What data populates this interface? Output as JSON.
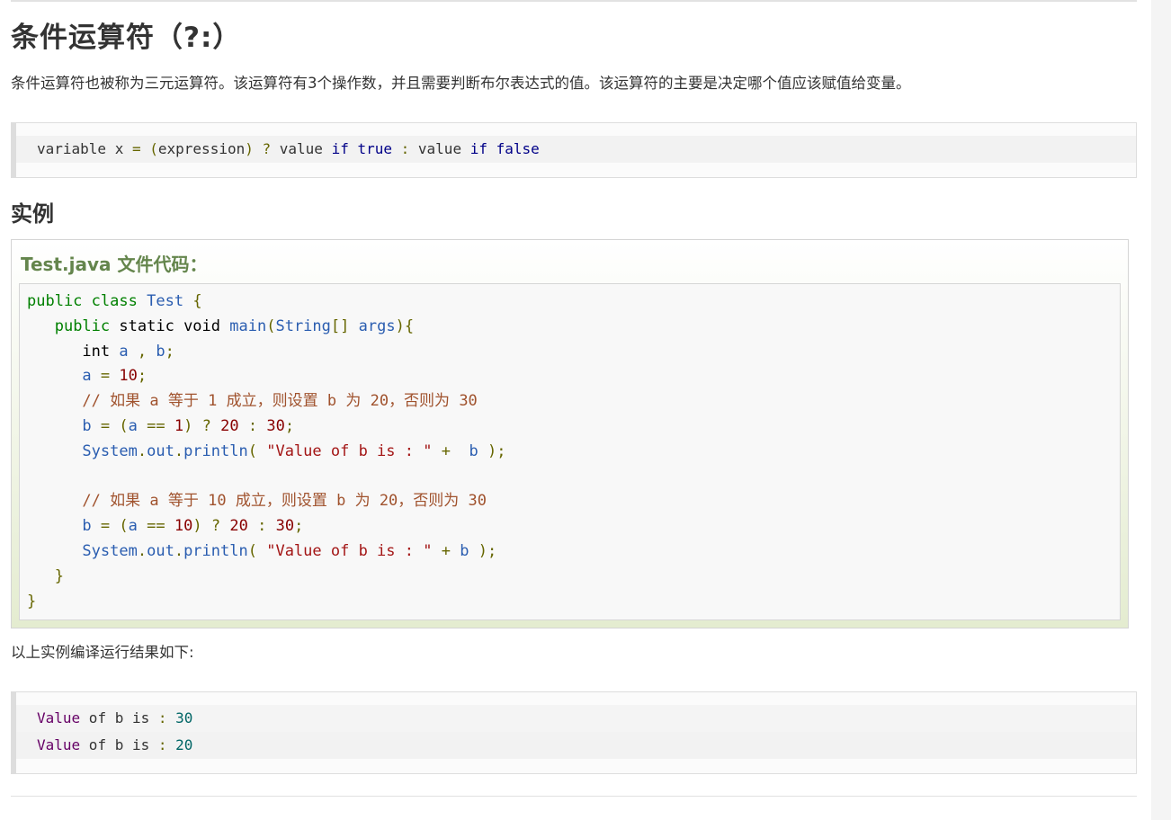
{
  "heading": "条件运算符（?:）",
  "description": "条件运算符也被称为三元运算符。该运算符有3个操作数，并且需要判断布尔表达式的值。该运算符的主要是决定哪个值应该赋值给变量。",
  "syntax": {
    "t1": "variable x ",
    "t2": "=",
    "t3": " ",
    "t4": "(",
    "t5": "expression",
    "t6": ")",
    "t7": " ? ",
    "t8": "value ",
    "t9": "if",
    "t10": " ",
    "t11": "true",
    "t12": " : ",
    "t13": "value ",
    "t14": "if",
    "t15": " ",
    "t16": "false"
  },
  "example_heading": "实例",
  "example_file_title": "Test.java 文件代码：",
  "java_lines": [
    "public class Test {",
    "   public static void main(String[] args){",
    "      int a , b;",
    "      a = 10;",
    "      // 如果 a 等于 1 成立，则设置 b 为 20，否则为 30",
    "      b = (a == 1) ? 20 : 30;",
    "      System.out.println( \"Value of b is : \" +  b );",
    "",
    "      // 如果 a 等于 10 成立，则设置 b 为 20，否则为 30",
    "      b = (a == 10) ? 20 : 30;",
    "      System.out.println( \"Value of b is : \" + b );",
    "   }",
    "}"
  ],
  "result_label": "以上实例编译运行结果如下:",
  "output_lines": [
    {
      "a": "Value",
      "b": " of b is ",
      "c": ":",
      "d": " 30"
    },
    {
      "a": "Value",
      "b": " of b is ",
      "c": ":",
      "d": " 20"
    }
  ]
}
